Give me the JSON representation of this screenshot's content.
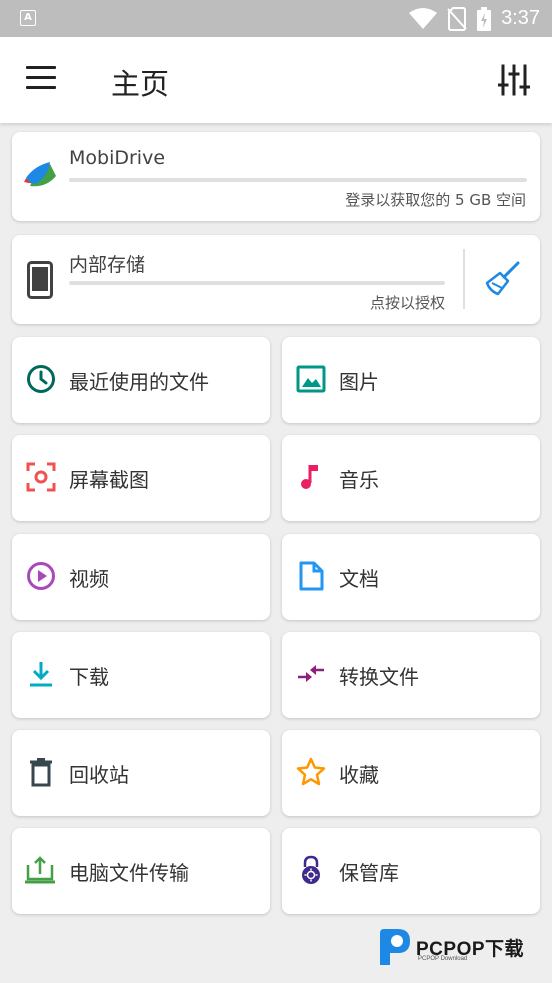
{
  "status_bar": {
    "notification_glyph": "A",
    "time": "3:37",
    "icons": [
      "wifi-icon",
      "no-sim-icon",
      "battery-charging-icon"
    ]
  },
  "app_bar": {
    "title": "主页",
    "menu_icon": "hamburger-menu-icon",
    "filter_icon": "sliders-icon"
  },
  "mobidrive": {
    "title": "MobiDrive",
    "subtitle": "登录以获取您的 5 GB 空间",
    "icon": "mobidrive-logo-icon"
  },
  "internal_storage": {
    "title": "内部存储",
    "subtitle": "点按以授权",
    "icon": "phone-icon",
    "clean_icon": "broom-icon"
  },
  "tiles": [
    {
      "label": "最近使用的文件",
      "icon": "clock-icon",
      "color": "#00695c"
    },
    {
      "label": "图片",
      "icon": "image-icon",
      "color": "#009688"
    },
    {
      "label": "屏幕截图",
      "icon": "screenshot-icon",
      "color": "#ef5350"
    },
    {
      "label": "音乐",
      "icon": "music-note-icon",
      "color": "#e91e63"
    },
    {
      "label": "视频",
      "icon": "play-circle-icon",
      "color": "#ab47bc"
    },
    {
      "label": "文档",
      "icon": "document-icon",
      "color": "#2196f3"
    },
    {
      "label": "下载",
      "icon": "download-icon",
      "color": "#00acc1"
    },
    {
      "label": "转换文件",
      "icon": "convert-icon",
      "color": "#8e1f7a"
    },
    {
      "label": "回收站",
      "icon": "trash-icon",
      "color": "#37474f"
    },
    {
      "label": "收藏",
      "icon": "star-icon",
      "color": "#ff9800"
    },
    {
      "label": "电脑文件传输",
      "icon": "pc-transfer-icon",
      "color": "#43a047"
    },
    {
      "label": "保管库",
      "icon": "vault-lock-icon",
      "color": "#3f2a8c"
    }
  ],
  "watermark": {
    "text": "PCPOP下载",
    "small": "PCPOP Download"
  }
}
